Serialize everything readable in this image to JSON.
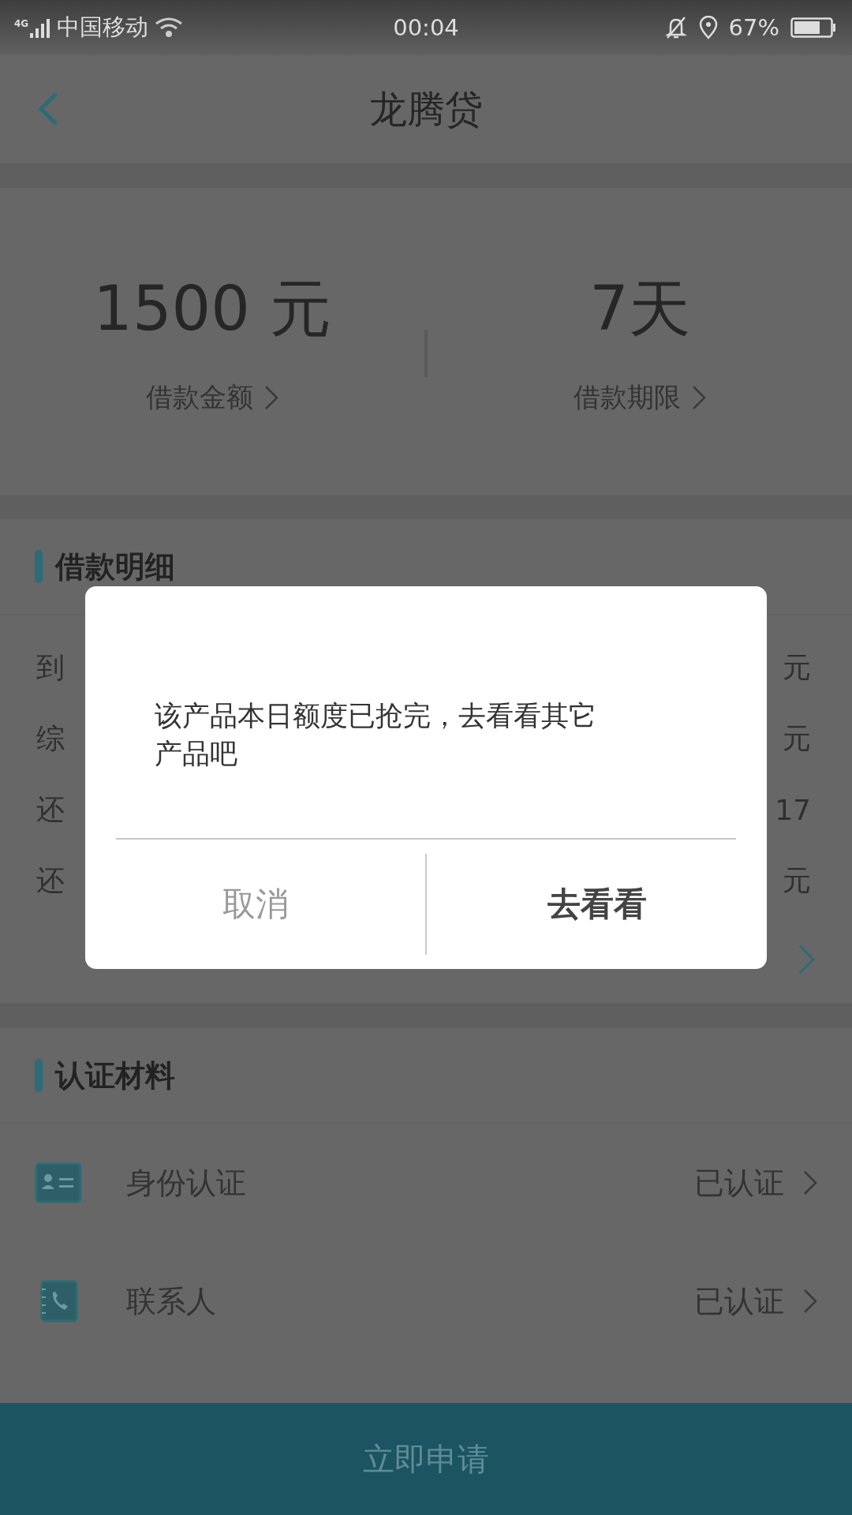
{
  "status_bar": {
    "network": "4G",
    "carrier": "中国移动",
    "time": "00:04",
    "battery": "67%"
  },
  "nav": {
    "title": "龙腾贷"
  },
  "summary": [
    {
      "value": "1500 元",
      "label": "借款金额"
    },
    {
      "value": "7天",
      "label": "借款期限"
    }
  ],
  "details": {
    "title": "借款明细",
    "rows": [
      {
        "label": "到",
        "value": "元"
      },
      {
        "label": "综",
        "value": "元"
      },
      {
        "label": "还",
        "value": "17"
      },
      {
        "label": "还",
        "value": "元"
      }
    ]
  },
  "materials": {
    "title": "认证材料",
    "items": [
      {
        "kind": "id",
        "label": "身份认证",
        "status": "已认证"
      },
      {
        "kind": "contact",
        "label": "联系人",
        "status": "已认证"
      }
    ]
  },
  "apply_button": "立即申请",
  "dialog": {
    "message": "该产品本日额度已抢完，去看看其它产品吧",
    "buttons": [
      {
        "label": "取消",
        "primary": false
      },
      {
        "label": "去看看",
        "primary": true
      }
    ]
  }
}
